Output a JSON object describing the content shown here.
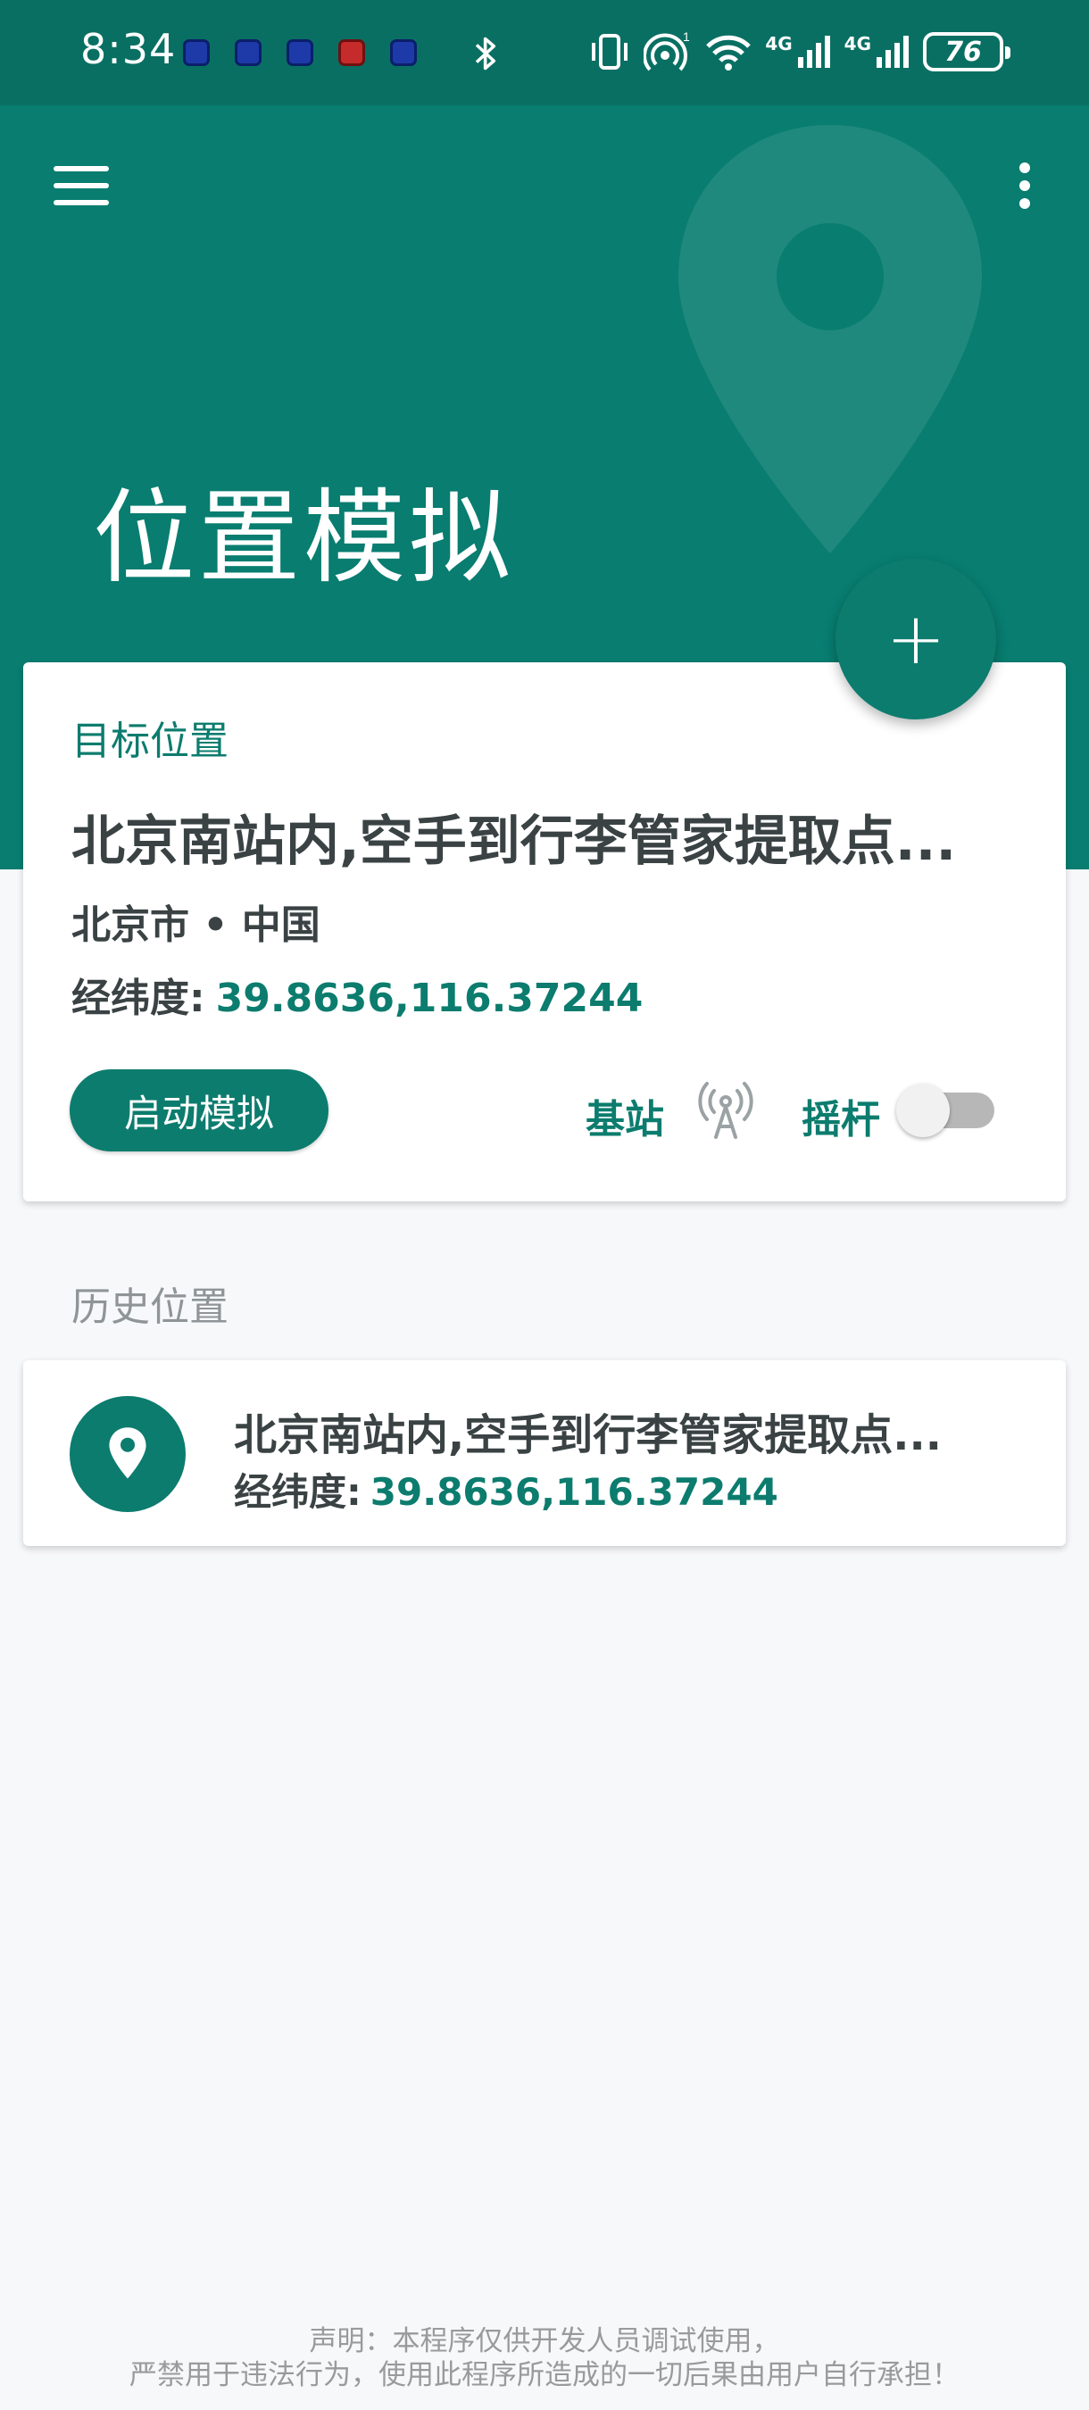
{
  "status_bar": {
    "time": "8:34",
    "network_1": "4G",
    "network_2": "4G",
    "battery": "76"
  },
  "header": {
    "title": "位置模拟"
  },
  "target": {
    "section_label": "目标位置",
    "place_name": "北京南站内,空手到行李管家提取点...",
    "region": "北京市 • 中国",
    "coord_label": "经纬度:",
    "coord_value": "39.8636,116.37244",
    "start_button": "启动模拟",
    "base_station_label": "基站",
    "joystick_label": "摇杆",
    "joystick_enabled": false
  },
  "fab": {
    "icon": "add-icon",
    "label": "+"
  },
  "history": {
    "title": "历史位置",
    "items": [
      {
        "name": "北京南站内,空手到行李管家提取点...",
        "coord_label": "经纬度:",
        "coord_value": "39.8636,116.37244"
      }
    ]
  },
  "disclaimer": {
    "line1": "声明：本程序仅供开发人员调试使用，",
    "line2": "严禁用于违法行为，使用此程序所造成的一切后果由用户自行承担！"
  },
  "colors": {
    "primary": "#0c7c6e",
    "status_bar": "#0a6f63",
    "header": "#087d70",
    "text_dark": "#3a4244",
    "text_muted": "#8f9597",
    "background": "#f7f8fa"
  }
}
